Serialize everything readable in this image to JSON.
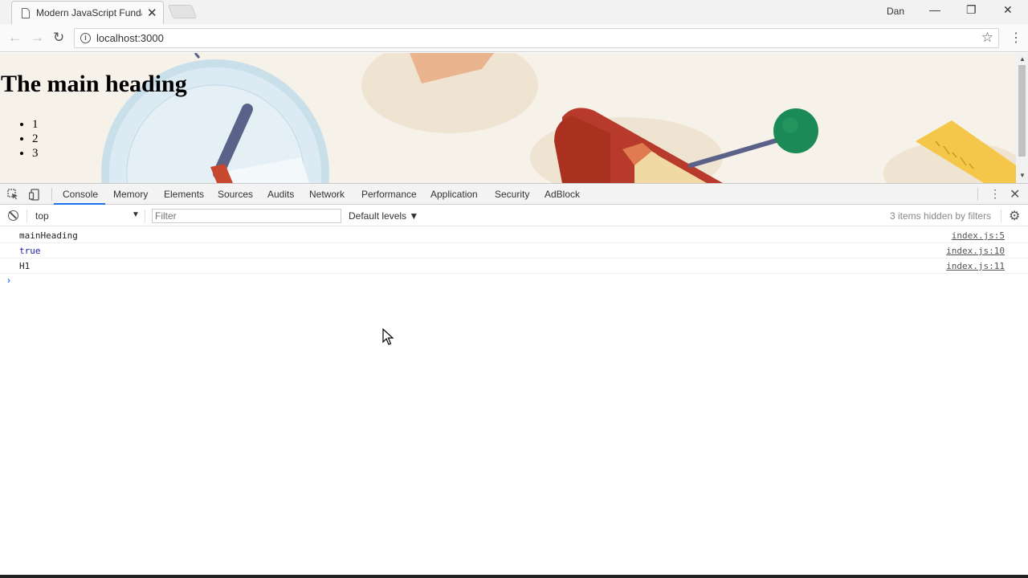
{
  "browser": {
    "tab_title": "Modern JavaScript Funda",
    "tab_close": "✕",
    "profile": "Dan",
    "url": "localhost:3000"
  },
  "page": {
    "heading": "The main heading",
    "list": [
      "1",
      "2",
      "3"
    ]
  },
  "devtools": {
    "tabs": [
      "Console",
      "Memory",
      "Elements",
      "Sources",
      "Audits",
      "Network",
      "Performance",
      "Application",
      "Security",
      "AdBlock"
    ],
    "active_tab": "Console",
    "context": "top",
    "filter_placeholder": "Filter",
    "levels": "Default levels ▼",
    "hidden_msg": "3 items hidden by filters"
  },
  "console": {
    "logs": [
      {
        "message": "mainHeading",
        "source": "index.js:5"
      },
      {
        "message": "true",
        "source": "index.js:10"
      },
      {
        "message": "H1",
        "source": "index.js:11"
      }
    ],
    "prompt": "›"
  },
  "colors": {
    "accent": "#1a73e8",
    "boolean": "#1a1aa6",
    "prompt": "#367cf1"
  }
}
